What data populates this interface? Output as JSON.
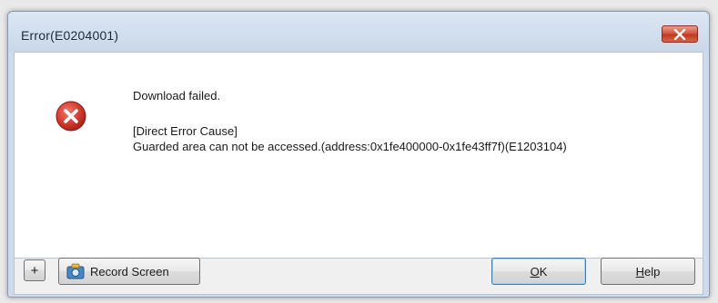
{
  "window": {
    "title": "Error(E0204001)"
  },
  "message": {
    "headline": "Download failed.",
    "cause_heading": "[Direct Error Cause]",
    "cause_text": "Guarded area can not be accessed.(address:0x1fe400000-0x1fe43ff7f)(E1203104)"
  },
  "icons": {
    "dialog": "error-icon",
    "close": "close-icon",
    "record": "camera-icon"
  },
  "buttons": {
    "expand_label": "+",
    "record_label": "Record Screen",
    "ok_label_prefix": "",
    "ok_label_mnemonic": "O",
    "ok_label_rest": "K",
    "help_label_mnemonic": "H",
    "help_label_rest": "elp"
  },
  "colors": {
    "error_red": "#d23a2e",
    "close_red": "#c2381f",
    "titlebar": "#cfdbea",
    "ok_border": "#3c7fb1"
  }
}
